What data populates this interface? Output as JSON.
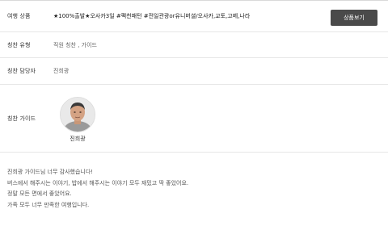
{
  "product": {
    "label": "여행 상품",
    "value": "★100%출발★오사카3일 #팩천패턴 #전일관광or유니버셜/오사카,교토,고베,나라",
    "button_label": "상품보기"
  },
  "praise_type": {
    "label": "칭찬 유형",
    "value": "직원 칭찬 , 가이드"
  },
  "manager": {
    "label": "칭찬 담당자",
    "value": "진희광"
  },
  "guide": {
    "label": "칭찬 가이드",
    "name": "진희광"
  },
  "review": {
    "lines": [
      "진희광 가이드님 너무 감사했습니다!",
      "버스에서 해주시는 이야기, 밥에서 해주시는 이야기 모두 재밌고 딱 좋았어요.",
      "정말 모든 면에서 좋았어요.",
      "가족 모두 너무 만족한 여행입니다."
    ]
  },
  "colors": {
    "button_bg": "#4a4a4a",
    "border": "#e6e6e6"
  }
}
